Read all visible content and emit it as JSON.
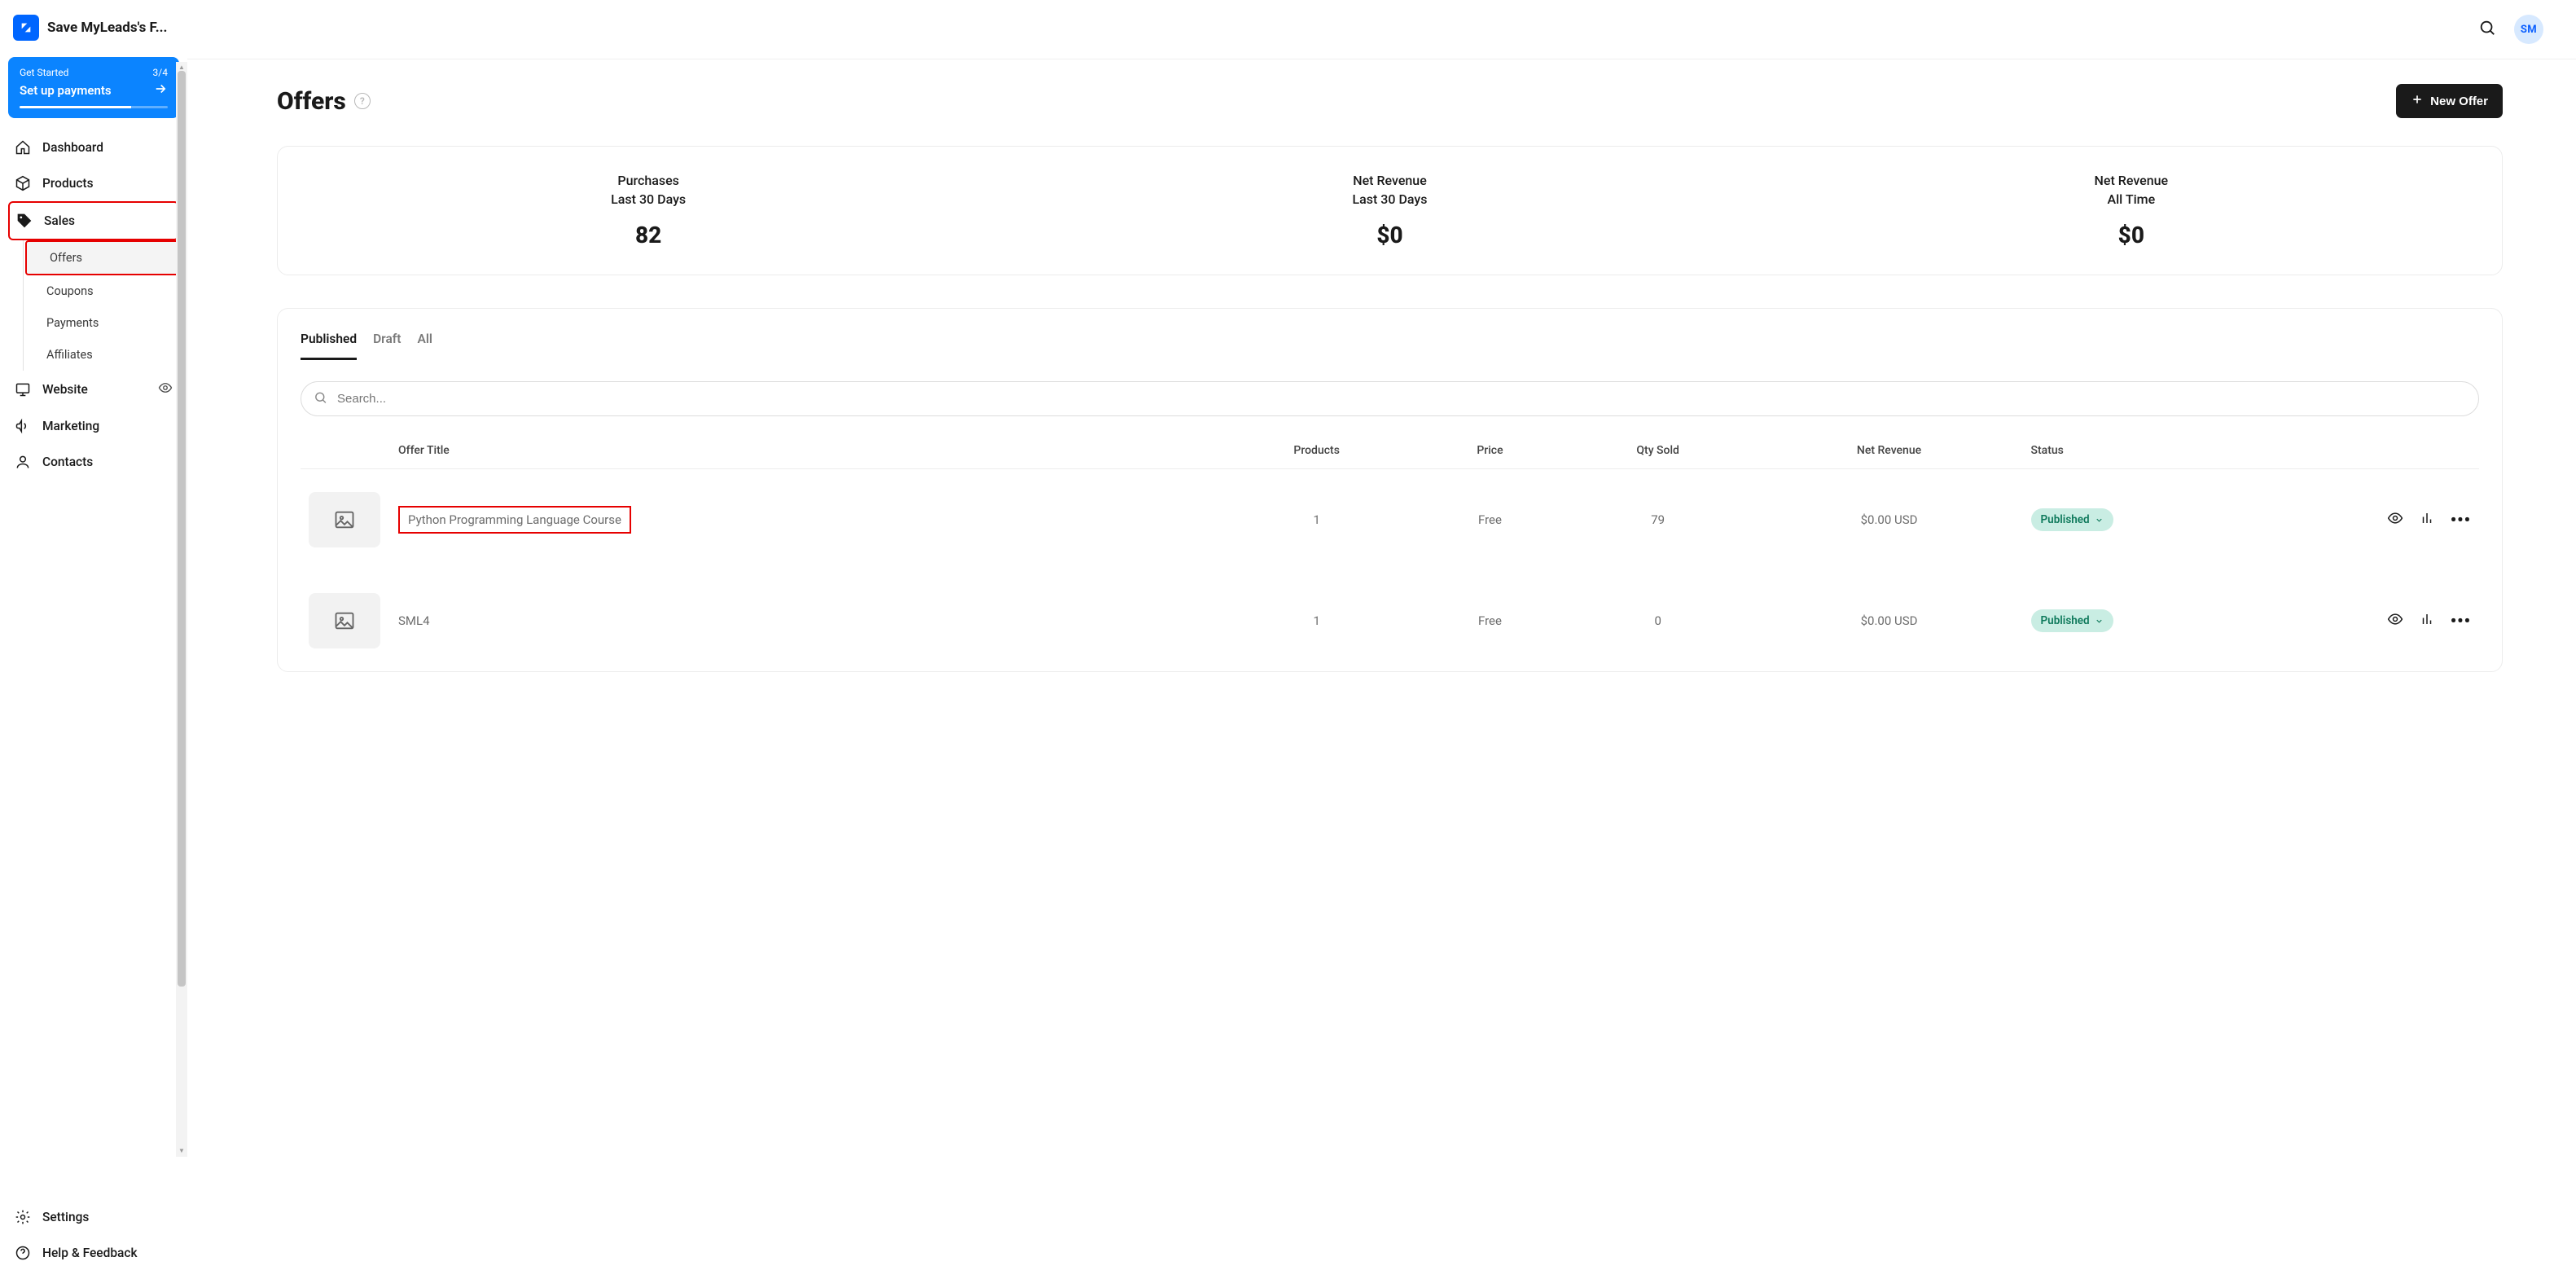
{
  "header": {
    "app_name": "Save MyLeads's F...",
    "avatar": "SM"
  },
  "getting_started": {
    "label": "Get Started",
    "progress_label": "3/4",
    "cta": "Set up payments"
  },
  "sidebar": {
    "dashboard": "Dashboard",
    "products": "Products",
    "sales": "Sales",
    "offers": "Offers",
    "coupons": "Coupons",
    "payments": "Payments",
    "affiliates": "Affiliates",
    "website": "Website",
    "marketing": "Marketing",
    "contacts": "Contacts",
    "settings": "Settings",
    "help": "Help & Feedback"
  },
  "page": {
    "title": "Offers",
    "new_offer": "New Offer",
    "search_placeholder": "Search..."
  },
  "metrics": [
    {
      "title": "Purchases",
      "period": "Last 30 Days",
      "value": "82"
    },
    {
      "title": "Net Revenue",
      "period": "Last 30 Days",
      "value": "$0"
    },
    {
      "title": "Net Revenue",
      "period": "All Time",
      "value": "$0"
    }
  ],
  "tabs": {
    "published": "Published",
    "draft": "Draft",
    "all": "All"
  },
  "table": {
    "headers": {
      "title": "Offer Title",
      "products": "Products",
      "price": "Price",
      "qty": "Qty Sold",
      "revenue": "Net Revenue",
      "status": "Status"
    },
    "rows": [
      {
        "name": "Python Programming Language Course",
        "products": "1",
        "price": "Free",
        "qty": "79",
        "revenue": "$0.00 USD",
        "status": "Published",
        "highlight": true
      },
      {
        "name": "SML4",
        "products": "1",
        "price": "Free",
        "qty": "0",
        "revenue": "$0.00 USD",
        "status": "Published",
        "highlight": false
      }
    ]
  }
}
